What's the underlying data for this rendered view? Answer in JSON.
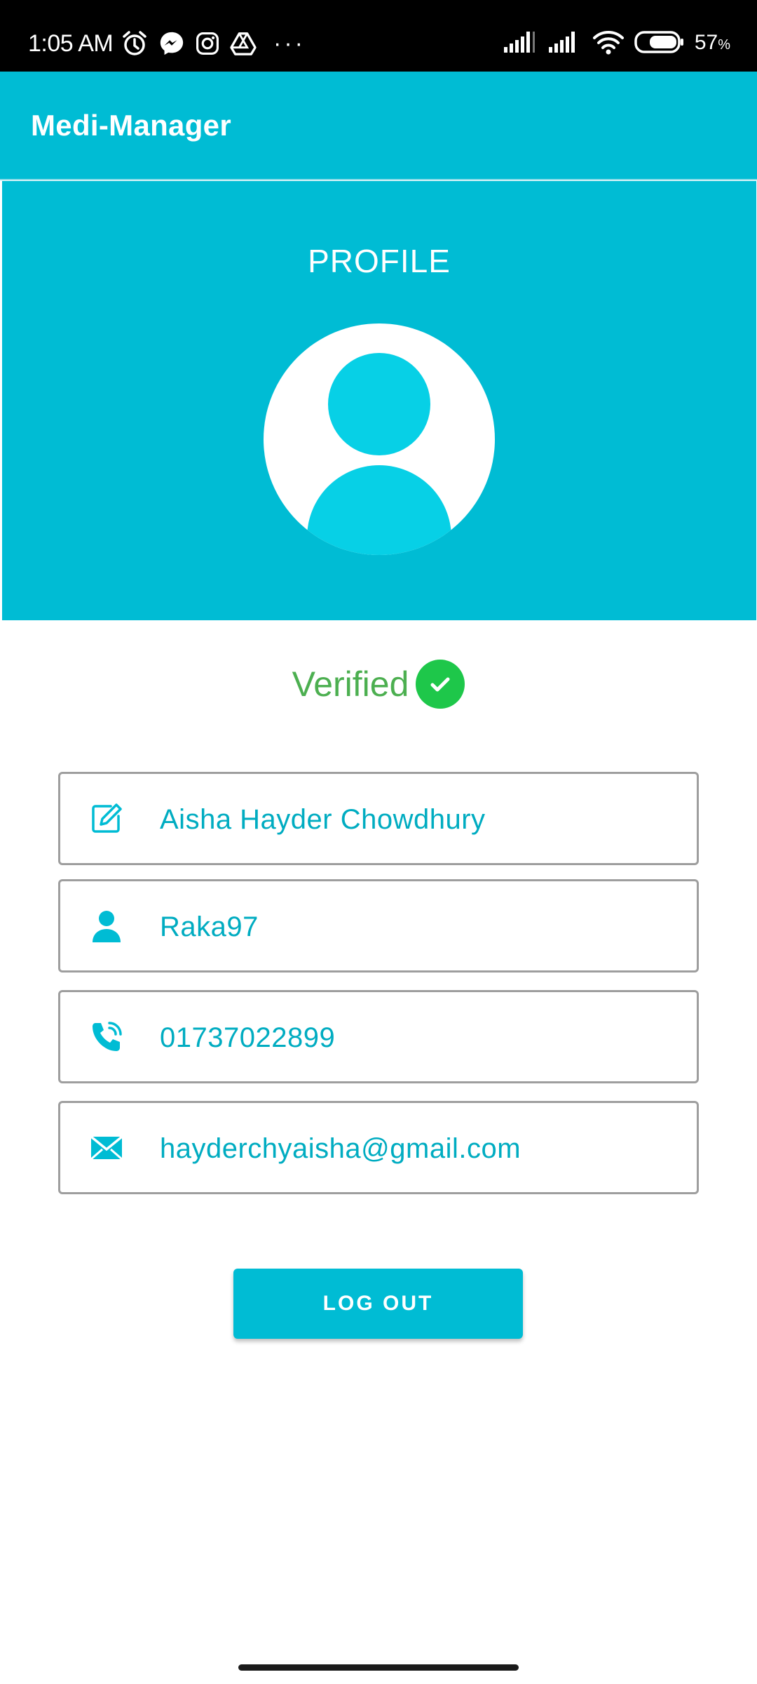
{
  "status_bar": {
    "time": "1:05 AM",
    "notification_icons": [
      "alarm-icon",
      "messenger-icon",
      "instagram-icon",
      "drive-icon"
    ],
    "more": "···",
    "battery_percent": "57",
    "battery_unit": "%"
  },
  "app_bar": {
    "title": "Medi-Manager"
  },
  "profile": {
    "heading": "PROFILE",
    "verified_label": "Verified"
  },
  "fields": {
    "full_name": "Aisha Hayder Chowdhury",
    "username": "Raka97",
    "phone": "01737022899",
    "email": "hayderchyaisha@gmail.com"
  },
  "actions": {
    "logout_label": "LOG OUT"
  },
  "colors": {
    "primary": "#00bcd4",
    "field_text": "#00acc1",
    "verified_text": "#4caf50",
    "verified_badge": "#1ec74a",
    "avatar_fill": "#07d0e6"
  }
}
